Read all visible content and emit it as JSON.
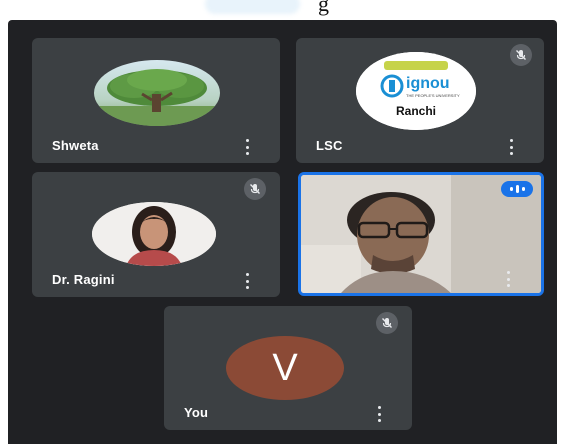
{
  "participants": [
    {
      "name": "Shweta",
      "avatar_type": "tree-photo"
    },
    {
      "name": "LSC",
      "avatar_type": "logo",
      "logo": {
        "brand": "ignou",
        "subtitle": "THE PEOPLE'S UNIVERSITY",
        "city": "Ranchi"
      }
    },
    {
      "name": "Dr. Ragini",
      "avatar_type": "photo"
    },
    {
      "name": "",
      "avatar_type": "video",
      "state": "speaking"
    },
    {
      "name": "You",
      "avatar_type": "letter",
      "letter": "V",
      "avatar_color": "#8b4a36"
    }
  ],
  "colors": {
    "background": "#202124",
    "tile": "#3c4043",
    "active_border": "#1a73e8"
  },
  "icons": {
    "mic_off": "mic-off-icon",
    "more": "more-vert-icon",
    "speaking": "audio-level-icon"
  }
}
